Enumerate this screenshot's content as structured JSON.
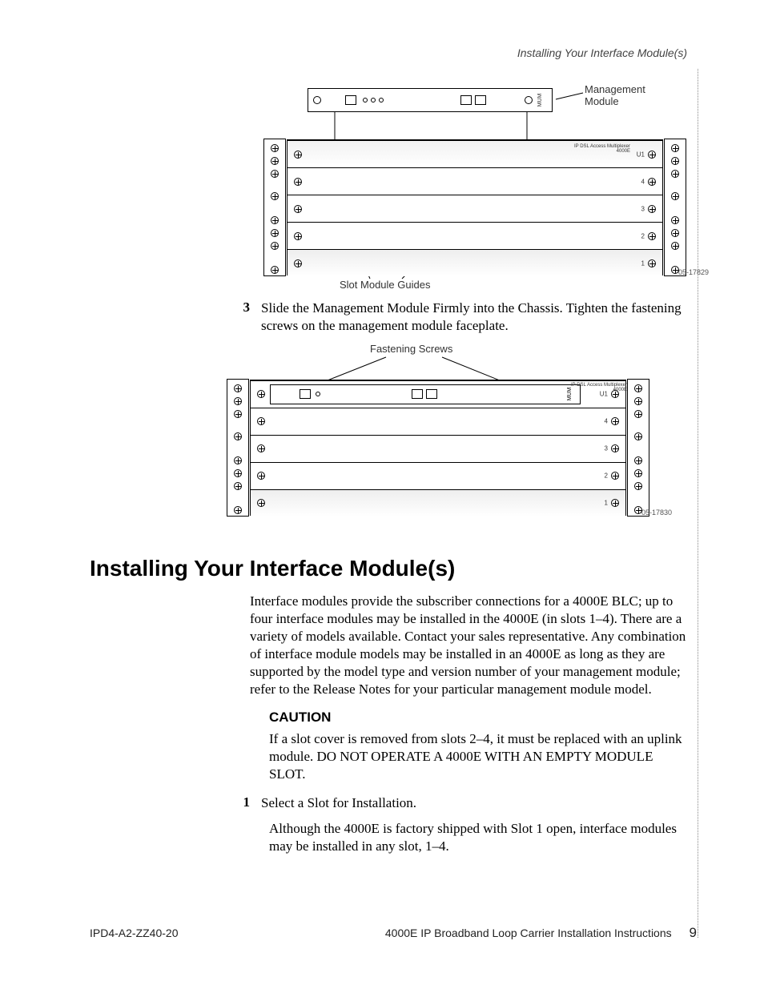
{
  "running_head": "Installing Your Interface Module(s)",
  "figure1": {
    "label_mgmt_module": "Management\nModule",
    "label_slot_guides": "Slot Module Guides",
    "mum_label": "MUM",
    "dsl_label": "IP DSL Access Multiplexer\n4000E",
    "stamp": "05-17829",
    "slots": [
      "U1",
      "4",
      "3",
      "2",
      "1"
    ]
  },
  "step3": {
    "num": "3",
    "text": "Slide the Management Module Firmly into the Chassis. Tighten the fastening screws on the management module faceplate."
  },
  "figure2": {
    "label_fastening": "Fastening Screws",
    "mum_label": "MUM",
    "dsl_label": "IP DSL Access Multiplexer\n4000E",
    "stamp": "05-17830",
    "slots": [
      "U1",
      "4",
      "3",
      "2",
      "1"
    ]
  },
  "heading": "Installing Your Interface Module(s)",
  "intro": "Interface modules provide the subscriber connections for a 4000E BLC; up to four interface modules may be installed in the 4000E (in slots 1–4). There are a variety of models available. Contact your sales representative. Any combination of interface module models may be installed in an 4000E as long as they are supported by the model type and version number of your management module; refer to the Release Notes for your particular management module model.",
  "caution": {
    "title": "CAUTION",
    "body": "If a slot cover is removed from slots 2–4, it must be replaced with an uplink module. DO NOT OPERATE A 4000E WITH AN EMPTY MODULE SLOT."
  },
  "step1": {
    "num": "1",
    "text": "Select a Slot for Installation.",
    "followup": "Although the 4000E is factory shipped with Slot 1 open, interface modules may be installed in any slot, 1–4."
  },
  "footer": {
    "left": "IPD4-A2-ZZ40-20",
    "right": "4000E IP Broadband Loop Carrier Installation Instructions",
    "page": "9"
  }
}
